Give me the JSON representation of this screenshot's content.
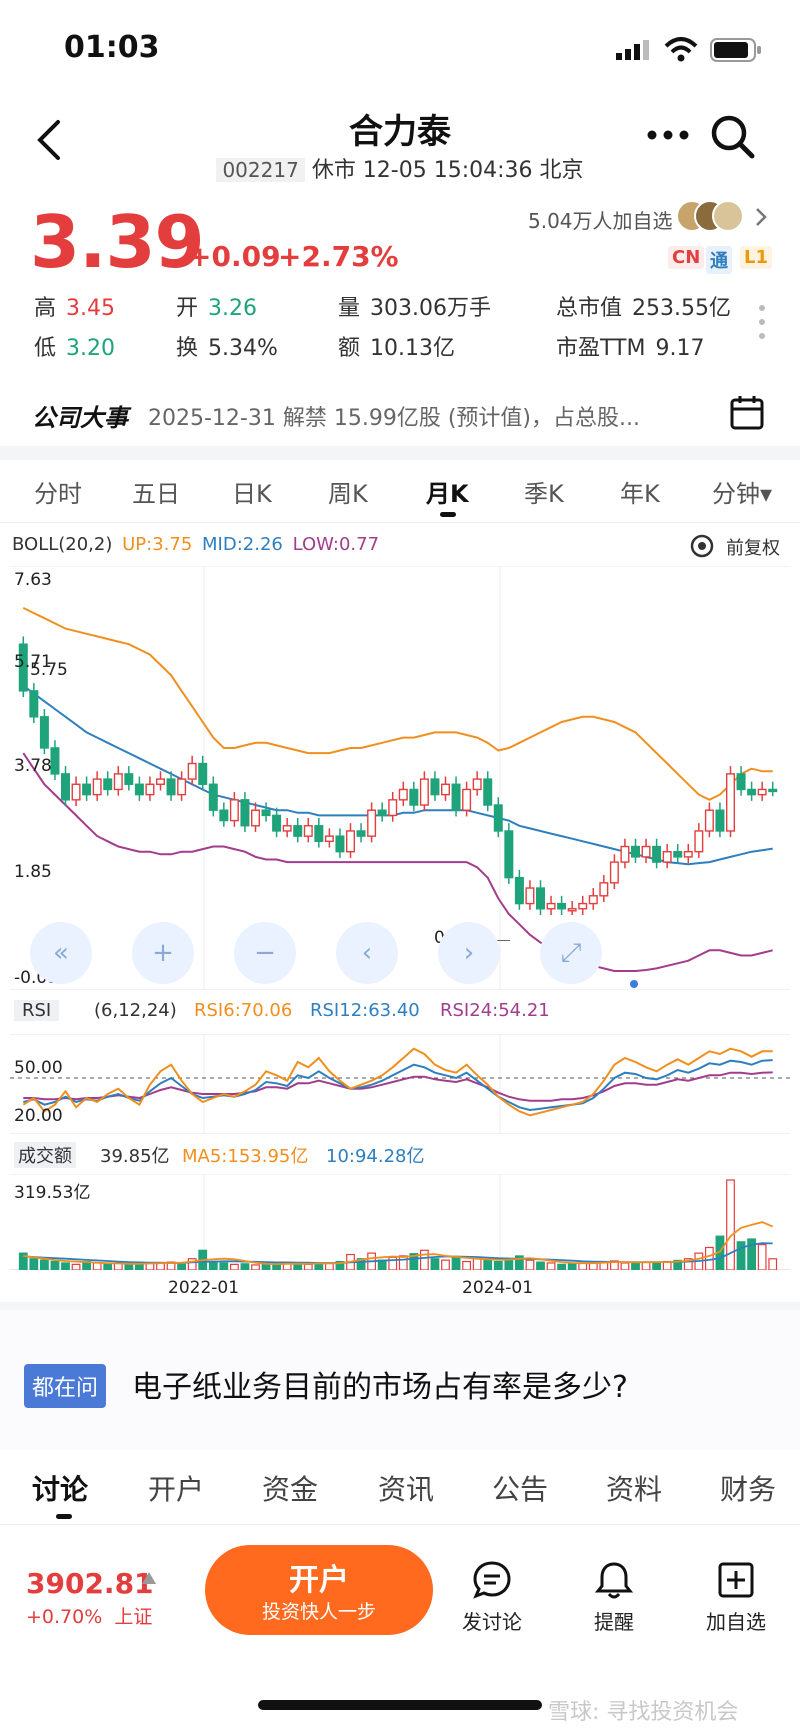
{
  "status_bar": {
    "time": "01:03"
  },
  "header": {
    "title": "合力泰",
    "code": "002217",
    "status_text": "休市 12-05 15:04:36 北京"
  },
  "quote": {
    "price": "3.39",
    "change": "+0.09",
    "change_pct": "+2.73%",
    "followers": "5.04万人加自选",
    "tags": [
      "CN",
      "通",
      "L1"
    ],
    "high_label": "高",
    "high": "3.45",
    "low_label": "低",
    "low": "3.20",
    "open_label": "开",
    "open": "3.26",
    "turnover_label": "换",
    "turnover": "5.34%",
    "volume_label": "量",
    "volume": "303.06万手",
    "amount_label": "额",
    "amount": "10.13亿",
    "mktcap_label": "总市值",
    "mktcap": "253.55亿",
    "pe_label": "市盈TTM",
    "pe": "9.17"
  },
  "event": {
    "label": "公司大事",
    "text": "2025-12-31 解禁 15.99亿股 (预计值)，占总股..."
  },
  "period_tabs": [
    "分时",
    "五日",
    "日K",
    "周K",
    "月K",
    "季K",
    "年K",
    "分钟▾"
  ],
  "active_period": "月K",
  "main_chart": {
    "boll_name": "BOLL(20,2)",
    "up": "UP:3.75",
    "mid": "MID:2.26",
    "low": "LOW:0.77",
    "adjust": "前复权",
    "y_labels": [
      "7.63",
      "5.71",
      "5.75",
      "3.78",
      "1.85",
      "-0.08"
    ],
    "min_marker": "0.99"
  },
  "rsi_chart": {
    "name": "RSI",
    "params": "(6,12,24)",
    "rsi6": "RSI6:70.06",
    "rsi12": "RSI12:63.40",
    "rsi24": "RSI24:54.21",
    "y_labels": [
      "50.00",
      "20.00"
    ]
  },
  "vol_chart": {
    "name": "成交额",
    "value": "39.85亿",
    "ma5": "MA5:153.95亿",
    "ma10": "10:94.28亿",
    "y_label": "319.53亿",
    "x_labels": [
      "2022-01",
      "2024-01"
    ]
  },
  "question": {
    "tag": "都在问",
    "text": "电子纸业务目前的市场占有率是多少?"
  },
  "bottom_tabs": [
    "讨论",
    "开户",
    "资金",
    "资讯",
    "公告",
    "资料",
    "财务"
  ],
  "index": {
    "value": "3902.81",
    "change": "+0.70%",
    "name": "上证"
  },
  "open_account": {
    "label": "开户",
    "sub": "投资快人一步"
  },
  "actions": [
    "发讨论",
    "提醒",
    "加自选"
  ],
  "watermark": "雪球: 寻找投资机会",
  "colors": {
    "red": "#e43d3d",
    "green": "#1ea37a",
    "orange": "#f08f1e",
    "blue": "#2f7fbf",
    "purple": "#a33c8c",
    "accent": "#ff6a1f"
  },
  "chart_data": {
    "type": "line",
    "candles": [
      {
        "o": 6.2,
        "c": 5.3
      },
      {
        "o": 5.3,
        "c": 4.8
      },
      {
        "o": 4.8,
        "c": 4.2
      },
      {
        "o": 4.2,
        "c": 3.7
      },
      {
        "o": 3.7,
        "c": 3.2
      },
      {
        "o": 3.2,
        "c": 3.5
      },
      {
        "o": 3.5,
        "c": 3.3
      },
      {
        "o": 3.3,
        "c": 3.6
      },
      {
        "o": 3.6,
        "c": 3.4
      },
      {
        "o": 3.4,
        "c": 3.7
      },
      {
        "o": 3.7,
        "c": 3.5
      },
      {
        "o": 3.5,
        "c": 3.3
      },
      {
        "o": 3.3,
        "c": 3.5
      },
      {
        "o": 3.5,
        "c": 3.6
      },
      {
        "o": 3.6,
        "c": 3.3
      },
      {
        "o": 3.3,
        "c": 3.6
      },
      {
        "o": 3.6,
        "c": 3.9
      },
      {
        "o": 3.9,
        "c": 3.5
      },
      {
        "o": 3.5,
        "c": 3.0
      },
      {
        "o": 3.0,
        "c": 2.8
      },
      {
        "o": 2.8,
        "c": 3.2
      },
      {
        "o": 3.2,
        "c": 2.7
      },
      {
        "o": 2.7,
        "c": 3.0
      },
      {
        "o": 3.0,
        "c": 2.9
      },
      {
        "o": 2.9,
        "c": 2.6
      },
      {
        "o": 2.6,
        "c": 2.7
      },
      {
        "o": 2.7,
        "c": 2.5
      },
      {
        "o": 2.5,
        "c": 2.7
      },
      {
        "o": 2.7,
        "c": 2.4
      },
      {
        "o": 2.4,
        "c": 2.5
      },
      {
        "o": 2.5,
        "c": 2.2
      },
      {
        "o": 2.2,
        "c": 2.6
      },
      {
        "o": 2.6,
        "c": 2.5
      },
      {
        "o": 2.5,
        "c": 3.0
      },
      {
        "o": 3.0,
        "c": 2.9
      },
      {
        "o": 2.9,
        "c": 3.2
      },
      {
        "o": 3.2,
        "c": 3.4
      },
      {
        "o": 3.4,
        "c": 3.1
      },
      {
        "o": 3.1,
        "c": 3.6
      },
      {
        "o": 3.6,
        "c": 3.3
      },
      {
        "o": 3.3,
        "c": 3.5
      },
      {
        "o": 3.5,
        "c": 3.0
      },
      {
        "o": 3.0,
        "c": 3.4
      },
      {
        "o": 3.4,
        "c": 3.6
      },
      {
        "o": 3.6,
        "c": 3.1
      },
      {
        "o": 3.1,
        "c": 2.6
      },
      {
        "o": 2.6,
        "c": 1.7
      },
      {
        "o": 1.7,
        "c": 1.2
      },
      {
        "o": 1.2,
        "c": 1.5
      },
      {
        "o": 1.5,
        "c": 1.1
      },
      {
        "o": 1.1,
        "c": 1.2
      },
      {
        "o": 1.2,
        "c": 1.1
      },
      {
        "o": 1.1,
        "c": 1.1
      },
      {
        "o": 1.1,
        "c": 1.2
      },
      {
        "o": 1.2,
        "c": 1.35
      },
      {
        "o": 1.35,
        "c": 1.6
      },
      {
        "o": 1.6,
        "c": 2.0
      },
      {
        "o": 2.0,
        "c": 2.3
      },
      {
        "o": 2.3,
        "c": 2.1
      },
      {
        "o": 2.1,
        "c": 2.3
      },
      {
        "o": 2.3,
        "c": 2.0
      },
      {
        "o": 2.0,
        "c": 2.2
      },
      {
        "o": 2.2,
        "c": 2.1
      },
      {
        "o": 2.1,
        "c": 2.2
      },
      {
        "o": 2.2,
        "c": 2.6
      },
      {
        "o": 2.6,
        "c": 3.0
      },
      {
        "o": 3.0,
        "c": 2.6
      },
      {
        "o": 2.6,
        "c": 3.7
      },
      {
        "o": 3.7,
        "c": 3.4
      },
      {
        "o": 3.4,
        "c": 3.3
      },
      {
        "o": 3.3,
        "c": 3.4
      },
      {
        "o": 3.4,
        "c": 3.39
      }
    ],
    "boll_up": [
      6.9,
      6.8,
      6.7,
      6.6,
      6.5,
      6.45,
      6.4,
      6.35,
      6.3,
      6.25,
      6.2,
      6.1,
      6.0,
      5.8,
      5.6,
      5.3,
      5.0,
      4.7,
      4.4,
      4.2,
      4.2,
      4.25,
      4.3,
      4.3,
      4.25,
      4.2,
      4.15,
      4.1,
      4.1,
      4.1,
      4.15,
      4.2,
      4.2,
      4.25,
      4.3,
      4.35,
      4.4,
      4.4,
      4.45,
      4.5,
      4.5,
      4.5,
      4.45,
      4.4,
      4.3,
      4.15,
      4.2,
      4.3,
      4.4,
      4.5,
      4.6,
      4.7,
      4.75,
      4.8,
      4.8,
      4.75,
      4.7,
      4.6,
      4.5,
      4.3,
      4.1,
      3.9,
      3.7,
      3.5,
      3.3,
      3.2,
      3.3,
      3.5,
      3.7,
      3.8,
      3.75,
      3.75
    ],
    "boll_mid": [
      5.4,
      5.25,
      5.1,
      4.95,
      4.8,
      4.65,
      4.5,
      4.4,
      4.3,
      4.2,
      4.1,
      4.0,
      3.9,
      3.8,
      3.7,
      3.6,
      3.5,
      3.4,
      3.3,
      3.25,
      3.2,
      3.15,
      3.1,
      3.05,
      3.0,
      3.0,
      2.95,
      2.95,
      2.9,
      2.9,
      2.9,
      2.9,
      2.9,
      2.9,
      2.9,
      2.9,
      2.95,
      2.95,
      3.0,
      3.0,
      3.0,
      3.0,
      3.0,
      2.95,
      2.9,
      2.85,
      2.8,
      2.7,
      2.65,
      2.6,
      2.55,
      2.5,
      2.45,
      2.4,
      2.35,
      2.3,
      2.25,
      2.2,
      2.15,
      2.1,
      2.05,
      2.0,
      1.98,
      1.96,
      1.98,
      2.0,
      2.05,
      2.1,
      2.15,
      2.2,
      2.23,
      2.26
    ],
    "boll_low": [
      4.1,
      3.8,
      3.5,
      3.3,
      3.1,
      2.9,
      2.7,
      2.5,
      2.4,
      2.3,
      2.25,
      2.2,
      2.2,
      2.15,
      2.15,
      2.2,
      2.2,
      2.25,
      2.3,
      2.3,
      2.25,
      2.2,
      2.1,
      2.05,
      2.05,
      2.0,
      2.0,
      2.0,
      2.0,
      2.0,
      2.0,
      2.0,
      2.0,
      2.0,
      2.0,
      2.0,
      2.0,
      2.0,
      2.0,
      2.0,
      2.0,
      2.0,
      2.0,
      1.9,
      1.7,
      1.3,
      1.0,
      0.8,
      0.6,
      0.45,
      0.35,
      0.3,
      0.2,
      0.1,
      0.0,
      -0.05,
      -0.1,
      -0.1,
      -0.1,
      -0.08,
      -0.05,
      0.0,
      0.05,
      0.1,
      0.2,
      0.3,
      0.3,
      0.25,
      0.2,
      0.2,
      0.25,
      0.3
    ],
    "rsi6": [
      30,
      35,
      25,
      30,
      40,
      28,
      35,
      32,
      38,
      42,
      35,
      30,
      45,
      55,
      60,
      48,
      38,
      32,
      35,
      38,
      36,
      40,
      45,
      55,
      52,
      48,
      62,
      58,
      65,
      55,
      48,
      42,
      45,
      48,
      52,
      58,
      65,
      72,
      68,
      60,
      56,
      54,
      60,
      52,
      45,
      36,
      30,
      25,
      22,
      24,
      26,
      28,
      30,
      32,
      38,
      48,
      60,
      65,
      62,
      58,
      55,
      60,
      64,
      60,
      65,
      70,
      68,
      72,
      70,
      66,
      70,
      70.06
    ],
    "rsi12": [
      32,
      34,
      30,
      32,
      36,
      32,
      34,
      33,
      36,
      38,
      35,
      33,
      40,
      46,
      50,
      44,
      38,
      35,
      36,
      37,
      36,
      38,
      41,
      47,
      46,
      44,
      52,
      50,
      55,
      50,
      46,
      42,
      43,
      45,
      48,
      52,
      56,
      60,
      58,
      54,
      52,
      50,
      54,
      48,
      42,
      36,
      32,
      28,
      26,
      27,
      28,
      29,
      30,
      31,
      35,
      42,
      50,
      54,
      53,
      50,
      49,
      52,
      56,
      54,
      57,
      61,
      60,
      63,
      62,
      60,
      63,
      63.4
    ],
    "rsi24": [
      35,
      35,
      34,
      34,
      35,
      34,
      35,
      35,
      36,
      37,
      36,
      35,
      38,
      41,
      43,
      41,
      39,
      38,
      38,
      38,
      38,
      39,
      40,
      43,
      43,
      42,
      46,
      46,
      48,
      46,
      44,
      42,
      42,
      43,
      45,
      47,
      49,
      51,
      51,
      49,
      48,
      47,
      49,
      46,
      43,
      39,
      36,
      34,
      33,
      33,
      33,
      34,
      34,
      35,
      37,
      40,
      44,
      46,
      46,
      45,
      45,
      47,
      49,
      48,
      50,
      52,
      52,
      54,
      54,
      53,
      54,
      54.21
    ],
    "volume": [
      60,
      40,
      35,
      30,
      25,
      20,
      30,
      25,
      20,
      25,
      22,
      20,
      24,
      26,
      28,
      20,
      40,
      70,
      30,
      25,
      20,
      22,
      18,
      20,
      24,
      22,
      25,
      20,
      22,
      24,
      30,
      55,
      40,
      60,
      35,
      45,
      50,
      58,
      70,
      40,
      35,
      45,
      30,
      40,
      38,
      30,
      38,
      50,
      35,
      28,
      25,
      20,
      22,
      25,
      28,
      30,
      32,
      25,
      24,
      28,
      26,
      30,
      34,
      40,
      60,
      80,
      120,
      319.53,
      100,
      110,
      90,
      39.85
    ],
    "volume_up": [
      false,
      false,
      false,
      false,
      false,
      true,
      false,
      true,
      false,
      true,
      false,
      false,
      true,
      true,
      true,
      false,
      true,
      false,
      false,
      false,
      true,
      false,
      true,
      false,
      false,
      true,
      false,
      true,
      false,
      true,
      false,
      true,
      false,
      true,
      false,
      true,
      true,
      false,
      true,
      false,
      true,
      false,
      true,
      true,
      false,
      false,
      false,
      false,
      true,
      false,
      true,
      false,
      false,
      true,
      true,
      true,
      true,
      true,
      false,
      true,
      false,
      true,
      false,
      true,
      true,
      true,
      false,
      true,
      false,
      false,
      true,
      true
    ],
    "ma5_volume": [
      50,
      45,
      40,
      35,
      32,
      30,
      28,
      26,
      24,
      23,
      22,
      22,
      23,
      24,
      25,
      26,
      30,
      35,
      38,
      40,
      38,
      32,
      26,
      22,
      21,
      22,
      22,
      22,
      23,
      23,
      24,
      30,
      36,
      42,
      45,
      48,
      46,
      50,
      55,
      56,
      50,
      47,
      43,
      40,
      38,
      36,
      37,
      40,
      42,
      38,
      33,
      28,
      25,
      24,
      24,
      26,
      28,
      28,
      27,
      27,
      28,
      28,
      30,
      33,
      40,
      50,
      65,
      120,
      150,
      160,
      170,
      153.95
    ],
    "ma10_volume": [
      48,
      46,
      44,
      42,
      40,
      38,
      36,
      34,
      32,
      30,
      28,
      27,
      26,
      26,
      25,
      25,
      27,
      29,
      30,
      31,
      31,
      30,
      29,
      28,
      27,
      27,
      26,
      26,
      25,
      25,
      25,
      27,
      29,
      31,
      33,
      35,
      37,
      40,
      43,
      46,
      48,
      48,
      47,
      46,
      44,
      42,
      41,
      40,
      39,
      38,
      37,
      35,
      33,
      31,
      30,
      29,
      28,
      28,
      28,
      28,
      28,
      28,
      29,
      30,
      32,
      36,
      42,
      60,
      78,
      90,
      95,
      94.28
    ],
    "x_ticks": [
      "2022-01",
      "2024-01"
    ]
  }
}
